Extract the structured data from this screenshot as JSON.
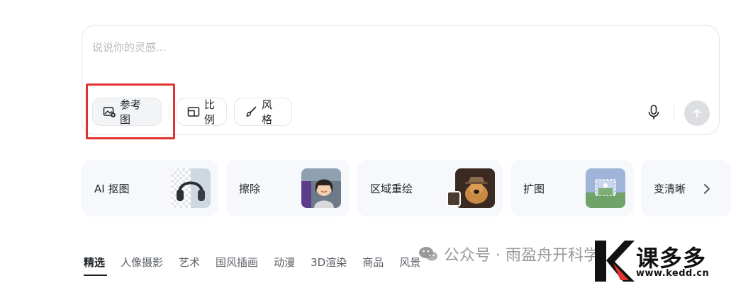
{
  "prompt": {
    "placeholder": "说说你的灵感..."
  },
  "toolbar": {
    "reference_label": "参考图",
    "ratio_label": "比例",
    "style_label": "风格",
    "mic_icon": "microphone-icon",
    "send_icon": "arrow-up-icon"
  },
  "features": [
    {
      "label": "AI 抠图",
      "icon": "headphones-thumbnail"
    },
    {
      "label": "擦除",
      "icon": "girl-portrait-thumbnail"
    },
    {
      "label": "区域重绘",
      "icon": "dog-with-hat-thumbnail"
    },
    {
      "label": "扩图",
      "icon": "landscape-thumbnail"
    },
    {
      "label": "变清晰",
      "icon": "enhance-thumbnail"
    }
  ],
  "tabs": [
    "精选",
    "人像摄影",
    "艺术",
    "国风插画",
    "动漫",
    "3D渲染",
    "商品",
    "风景"
  ],
  "active_tab": "精选",
  "watermark": {
    "text": "公众号 · 雨盈舟开科学",
    "icon": "wechat-icon"
  },
  "logo": {
    "text": "课多多",
    "url": "www.kedd.cn"
  },
  "colors": {
    "highlight": "#e0322e",
    "card_bg": "#f6f8fb",
    "send_disabled": "#dcdee2"
  }
}
